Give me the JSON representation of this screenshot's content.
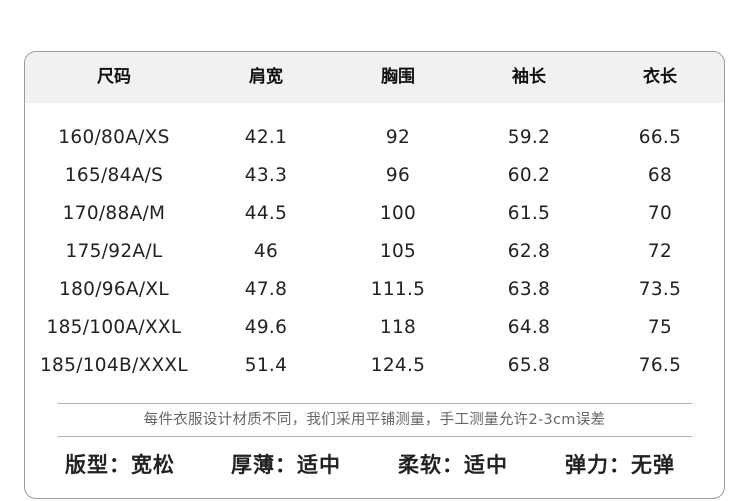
{
  "table": {
    "headers": [
      "尺码",
      "肩宽",
      "胸围",
      "袖长",
      "衣长"
    ],
    "rows": [
      [
        "160/80A/XS",
        "42.1",
        "92",
        "59.2",
        "66.5"
      ],
      [
        "165/84A/S",
        "43.3",
        "96",
        "60.2",
        "68"
      ],
      [
        "170/88A/M",
        "44.5",
        "100",
        "61.5",
        "70"
      ],
      [
        "175/92A/L",
        "46",
        "105",
        "62.8",
        "72"
      ],
      [
        "180/96A/XL",
        "47.8",
        "111.5",
        "63.8",
        "73.5"
      ],
      [
        "185/100A/XXL",
        "49.6",
        "118",
        "64.8",
        "75"
      ],
      [
        "185/104B/XXXL",
        "51.4",
        "124.5",
        "65.8",
        "76.5"
      ]
    ]
  },
  "note": "每件衣服设计材质不同，我们采用平铺测量，手工测量允许2-3cm误差",
  "properties": [
    "版型：宽松",
    "厚薄：适中",
    "柔软：适中",
    "弹力：无弹"
  ]
}
